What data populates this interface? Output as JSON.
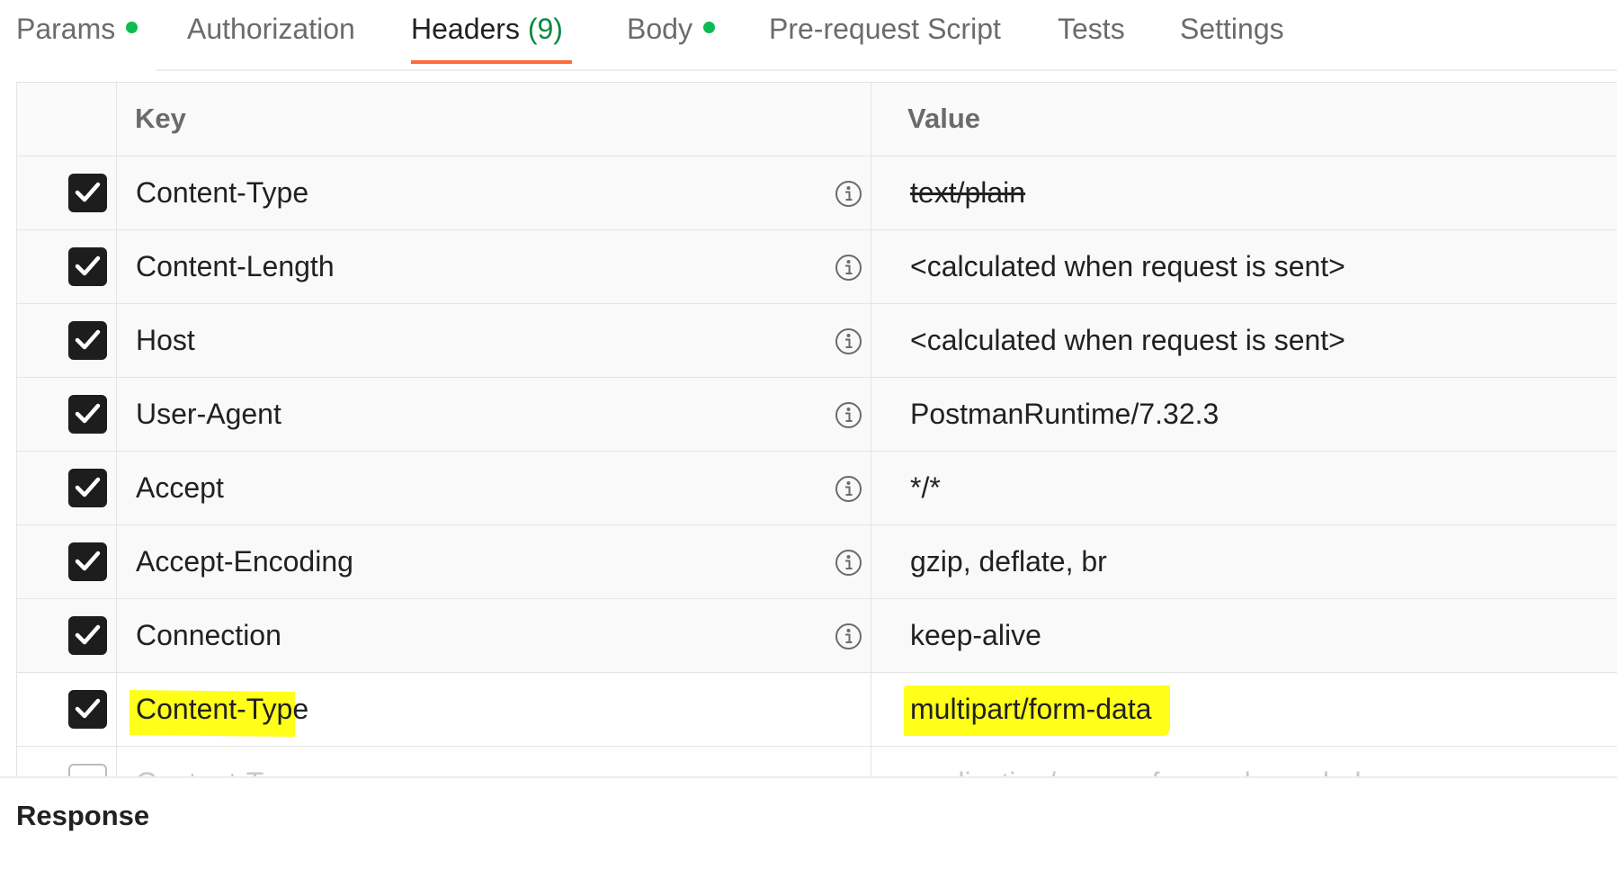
{
  "tabs": [
    {
      "label": "Params",
      "dot": true
    },
    {
      "label": "Authorization"
    },
    {
      "label": "Headers",
      "count": "(9)",
      "active": true
    },
    {
      "label": "Body",
      "dot": true
    },
    {
      "label": "Pre-request Script"
    },
    {
      "label": "Tests"
    },
    {
      "label": "Settings"
    }
  ],
  "table": {
    "key_header": "Key",
    "value_header": "Value",
    "rows": [
      {
        "key": "Content-Type",
        "value": "text/plain",
        "checked": true,
        "strikethrough": true
      },
      {
        "key": "Content-Length",
        "value": "<calculated when request is sent>",
        "checked": true
      },
      {
        "key": "Host",
        "value": "<calculated when request is sent>",
        "checked": true
      },
      {
        "key": "User-Agent",
        "value": "PostmanRuntime/7.32.3",
        "checked": true
      },
      {
        "key": "Accept",
        "value": "*/*",
        "checked": true
      },
      {
        "key": "Accept-Encoding",
        "value": "gzip, deflate, br",
        "checked": true
      },
      {
        "key": "Connection",
        "value": "keep-alive",
        "checked": true
      },
      {
        "key": "Content-Type",
        "value": "multipart/form-data",
        "checked": true,
        "highlighted": true
      },
      {
        "key": "Content-T",
        "value": "application/x-www-form-urlencoded",
        "checked": false,
        "partially_visible": true
      }
    ]
  },
  "response": {
    "label": "Response"
  },
  "colors": {
    "accent": "#ff6c37",
    "dot": "#0cbb52",
    "highlight": "#ffff1a"
  }
}
